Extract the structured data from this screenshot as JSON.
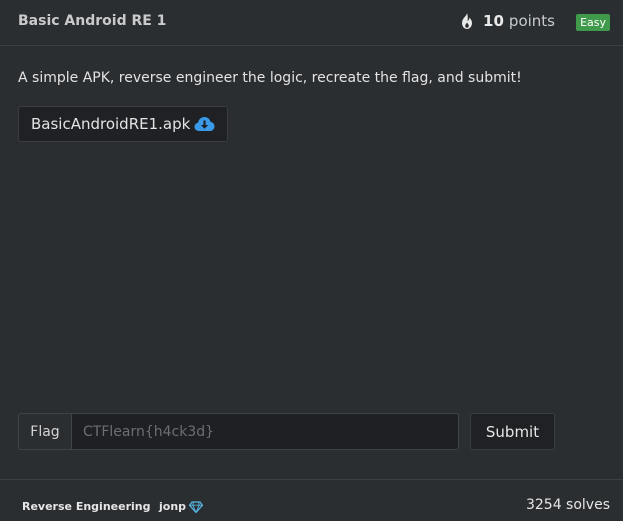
{
  "challenge": {
    "title": "Basic Android RE 1",
    "points_value": "10",
    "points_label": "points",
    "difficulty": "Easy",
    "description": "A simple APK, reverse engineer the logic, recreate the flag, and submit!",
    "file_name": "BasicAndroidRE1.apk"
  },
  "flag_form": {
    "label": "Flag",
    "placeholder": "CTFlearn{h4ck3d}",
    "value": "",
    "submit_label": "Submit"
  },
  "footer": {
    "category": "Reverse Engineering",
    "separator": "·",
    "author": "jonp",
    "solves": "3254 solves"
  },
  "icons": {
    "points": "flame-icon",
    "download": "cloud-download-icon",
    "author_badge": "diamond-icon"
  },
  "colors": {
    "background": "#2b2e31",
    "easy_badge": "#3f9b4b",
    "download_icon": "#3b9ae8",
    "diamond_icon": "#58b9e8"
  }
}
